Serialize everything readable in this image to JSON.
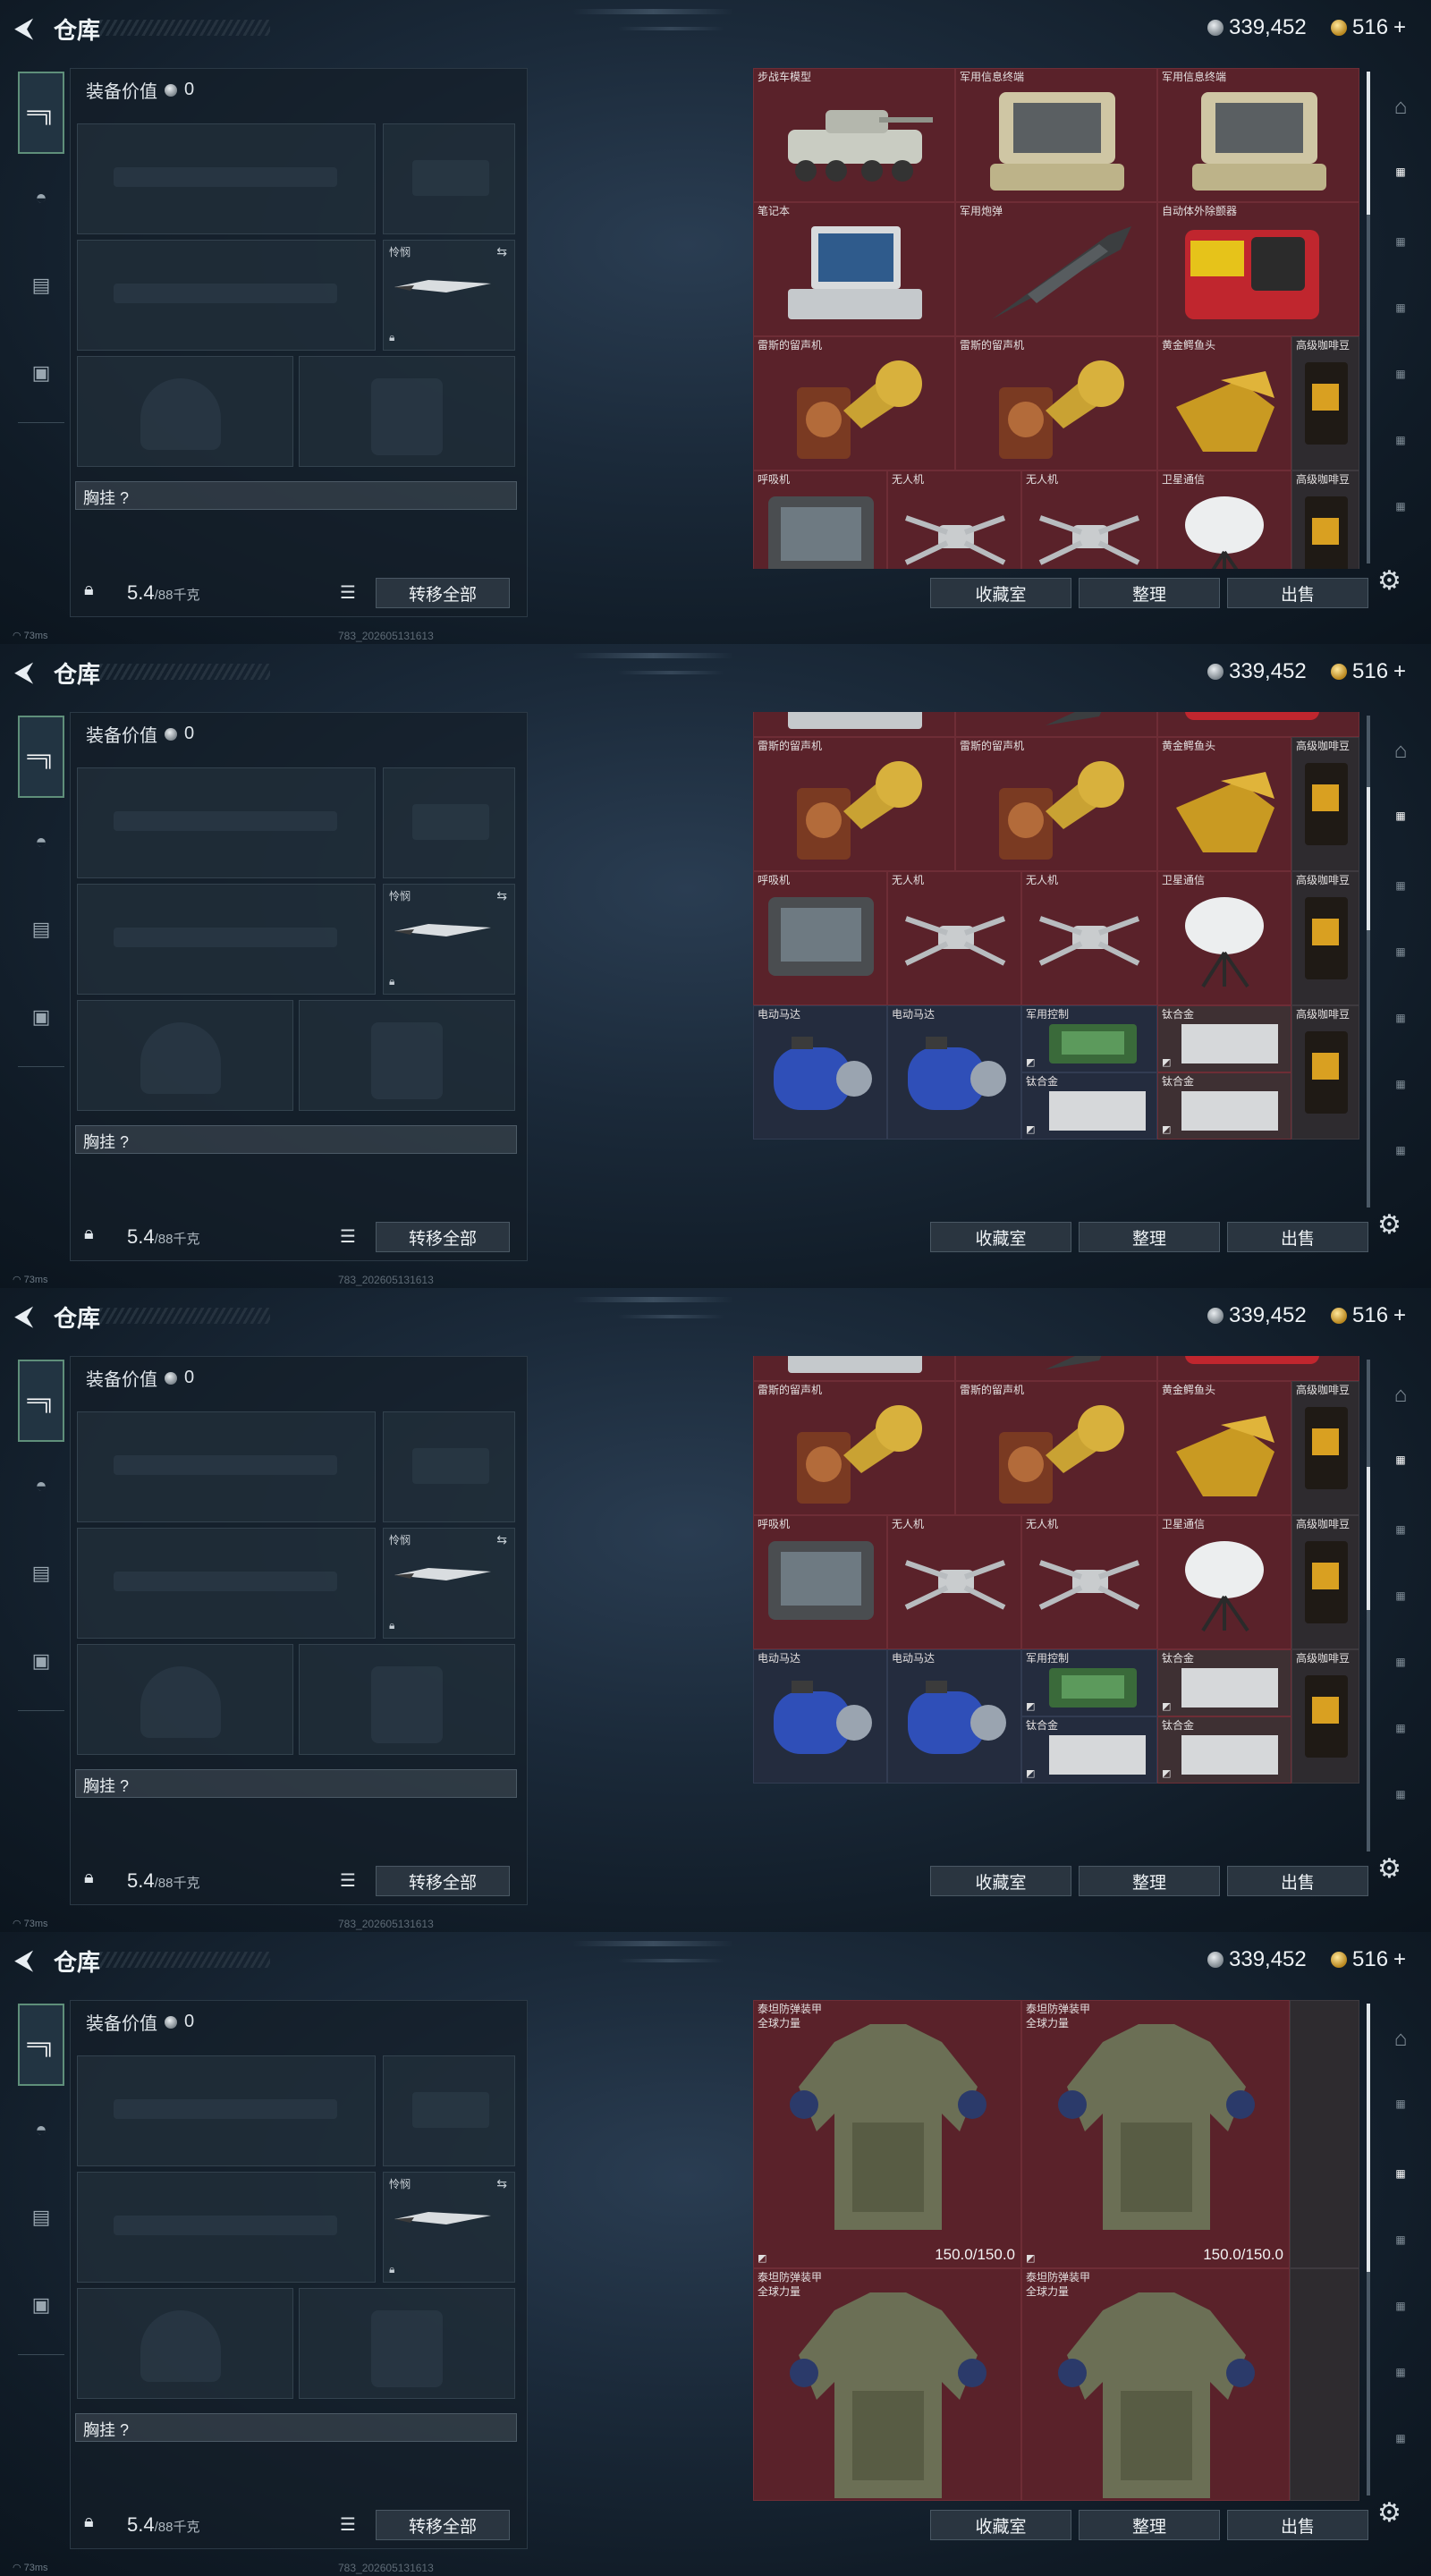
{
  "header": {
    "title": "仓库",
    "silver": "339,452",
    "gold": "516"
  },
  "rail": [
    "pistol-icon",
    "helmet-icon",
    "backpack-icon",
    "case-icon"
  ],
  "equipment": {
    "value_label": "装备价值",
    "value": "0",
    "knife_label": "怜悯",
    "chest_label": "胸挂 ?",
    "weight": "5.4",
    "weight_max": "/88千克",
    "transfer_all": "转移全部"
  },
  "buttons": {
    "collect": "收藏室",
    "sort": "整理",
    "sell": "出售"
  },
  "status": {
    "ping": "73ms",
    "build": "783_202605131613"
  },
  "items": {
    "tank": "步战车模型",
    "terminal": "军用信息终端",
    "laptop": "笔记本",
    "shell": "军用炮弹",
    "detector": "自动体外除颤器",
    "phonograph": "雷斯的留声机",
    "croc": "黄金鳄鱼头",
    "coffee": "高级咖啡豆",
    "pager": "呼吸机",
    "drone": "无人机",
    "satellite": "卫星通信",
    "motor": "电动马达",
    "board": "军用控制",
    "titanium": "钛合金",
    "armor": "泰坦防弹装甲",
    "armor_sub": "全球力量",
    "armor_dur": "150.0/150.0"
  }
}
